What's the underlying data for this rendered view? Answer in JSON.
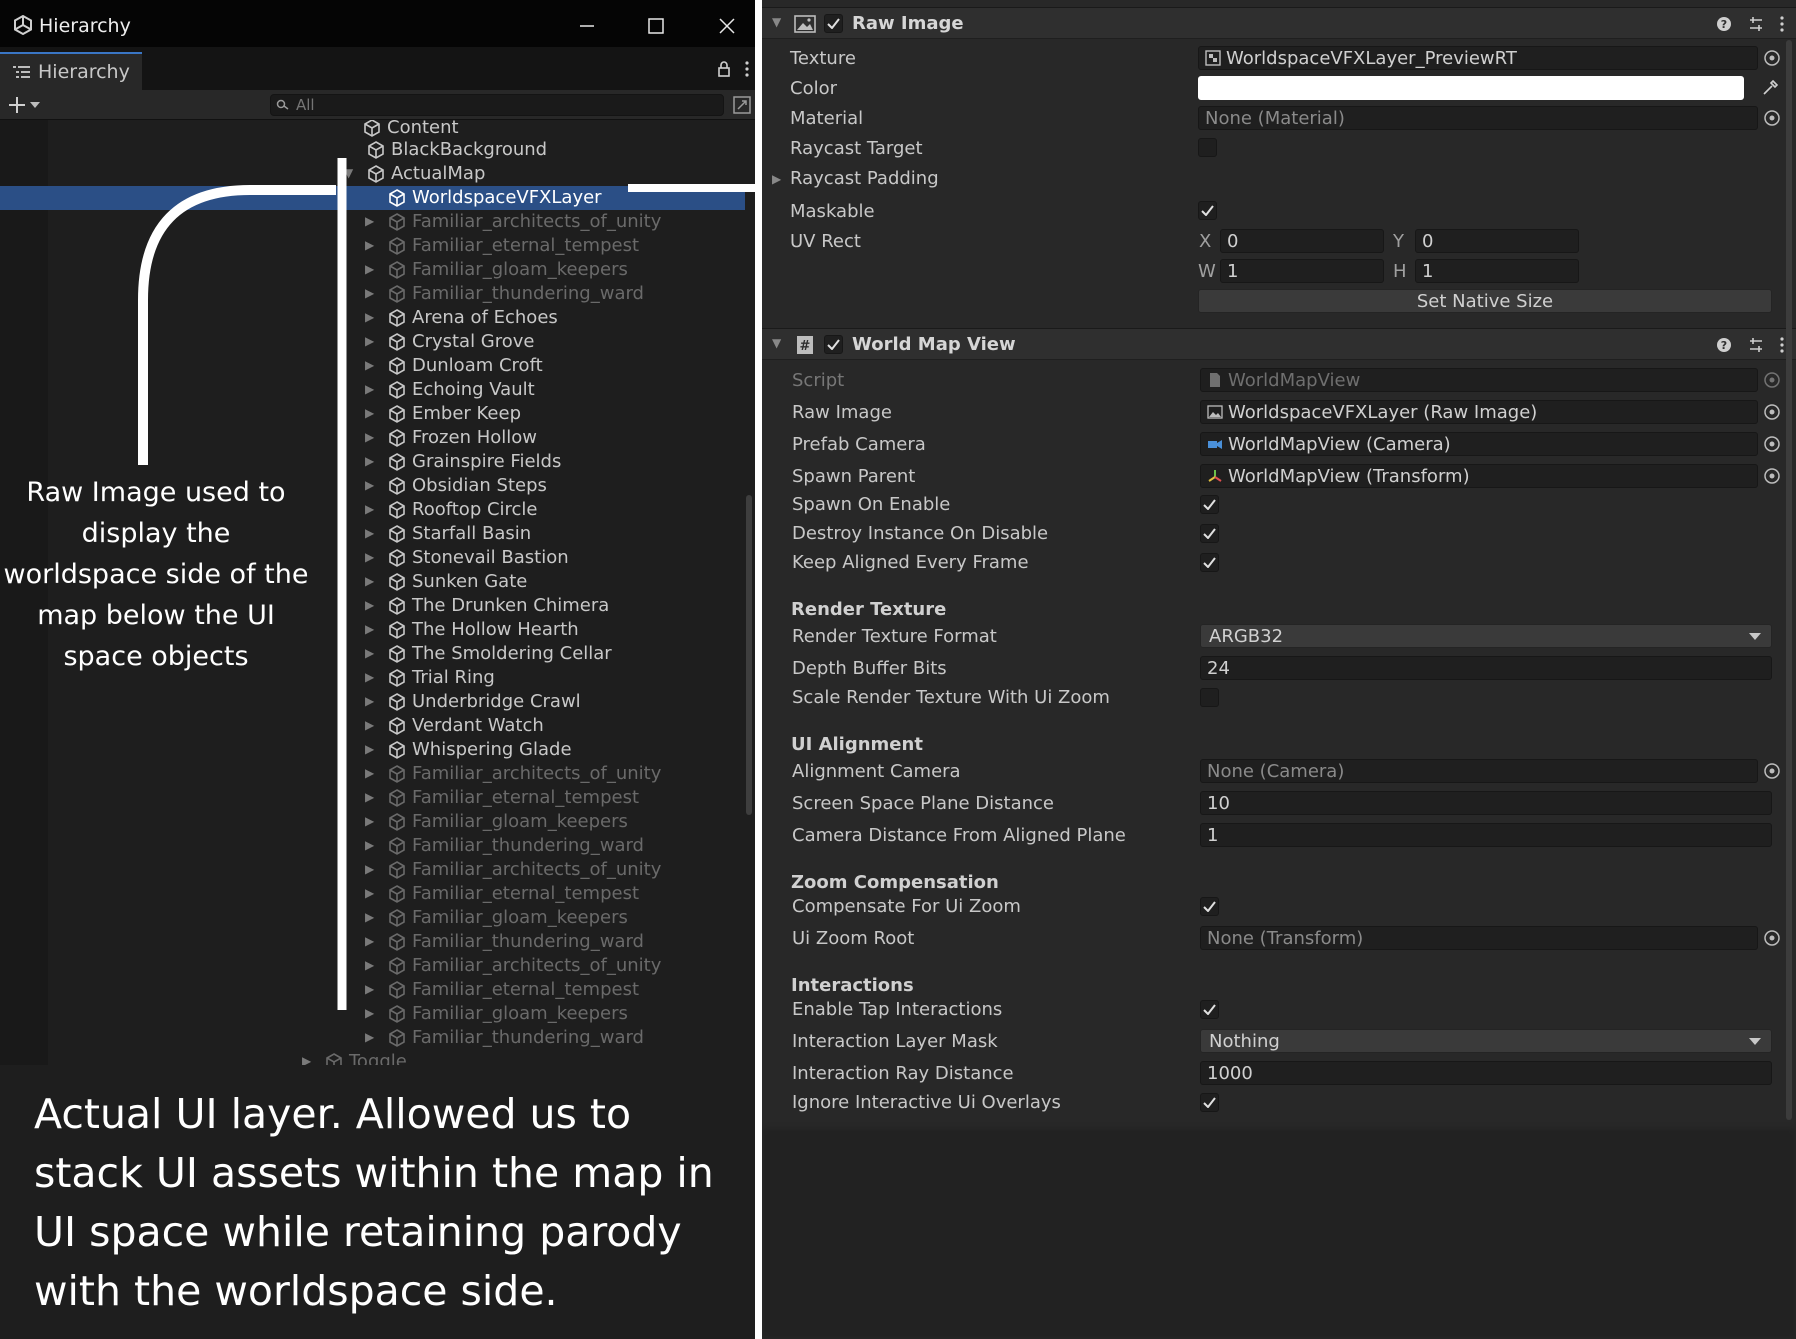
{
  "window": {
    "title": "Hierarchy",
    "minimize_icon": "minimize-icon",
    "maximize_icon": "maximize-icon",
    "close_icon": "close-icon"
  },
  "hierarchy": {
    "tab_label": "Hierarchy",
    "search_placeholder": "All",
    "truncated_top": "Content",
    "items": [
      {
        "label": "BlackBackground",
        "depth": 1,
        "expand": "none",
        "state": "active"
      },
      {
        "label": "ActualMap",
        "depth": 1,
        "expand": "open",
        "state": "active"
      },
      {
        "label": "WorldspaceVFXLayer",
        "depth": 2,
        "expand": "none",
        "state": "selected"
      },
      {
        "label": "Familiar_architects_of_unity",
        "depth": 2,
        "expand": "closed",
        "state": "inactive"
      },
      {
        "label": "Familiar_eternal_tempest",
        "depth": 2,
        "expand": "closed",
        "state": "inactive"
      },
      {
        "label": "Familiar_gloam_keepers",
        "depth": 2,
        "expand": "closed",
        "state": "inactive"
      },
      {
        "label": "Familiar_thundering_ward",
        "depth": 2,
        "expand": "closed",
        "state": "inactive"
      },
      {
        "label": "Arena of Echoes",
        "depth": 2,
        "expand": "closed",
        "state": "active"
      },
      {
        "label": "Crystal Grove",
        "depth": 2,
        "expand": "closed",
        "state": "active"
      },
      {
        "label": "Dunloam Croft",
        "depth": 2,
        "expand": "closed",
        "state": "active"
      },
      {
        "label": "Echoing Vault",
        "depth": 2,
        "expand": "closed",
        "state": "active"
      },
      {
        "label": "Ember Keep",
        "depth": 2,
        "expand": "closed",
        "state": "active"
      },
      {
        "label": "Frozen Hollow",
        "depth": 2,
        "expand": "closed",
        "state": "active"
      },
      {
        "label": "Grainspire Fields",
        "depth": 2,
        "expand": "closed",
        "state": "active"
      },
      {
        "label": "Obsidian Steps",
        "depth": 2,
        "expand": "closed",
        "state": "active"
      },
      {
        "label": "Rooftop Circle",
        "depth": 2,
        "expand": "closed",
        "state": "active"
      },
      {
        "label": "Starfall Basin",
        "depth": 2,
        "expand": "closed",
        "state": "active"
      },
      {
        "label": "Stonevail Bastion",
        "depth": 2,
        "expand": "closed",
        "state": "active"
      },
      {
        "label": "Sunken Gate",
        "depth": 2,
        "expand": "closed",
        "state": "active"
      },
      {
        "label": "The Drunken Chimera",
        "depth": 2,
        "expand": "closed",
        "state": "active"
      },
      {
        "label": "The Hollow Hearth",
        "depth": 2,
        "expand": "closed",
        "state": "active"
      },
      {
        "label": "The Smoldering Cellar",
        "depth": 2,
        "expand": "closed",
        "state": "active"
      },
      {
        "label": "Trial Ring",
        "depth": 2,
        "expand": "closed",
        "state": "active"
      },
      {
        "label": "Underbridge Crawl",
        "depth": 2,
        "expand": "closed",
        "state": "active"
      },
      {
        "label": "Verdant Watch",
        "depth": 2,
        "expand": "closed",
        "state": "active"
      },
      {
        "label": "Whispering Glade",
        "depth": 2,
        "expand": "closed",
        "state": "active"
      },
      {
        "label": "Familiar_architects_of_unity",
        "depth": 2,
        "expand": "closed",
        "state": "inactive"
      },
      {
        "label": "Familiar_eternal_tempest",
        "depth": 2,
        "expand": "closed",
        "state": "inactive"
      },
      {
        "label": "Familiar_gloam_keepers",
        "depth": 2,
        "expand": "closed",
        "state": "inactive"
      },
      {
        "label": "Familiar_thundering_ward",
        "depth": 2,
        "expand": "closed",
        "state": "inactive"
      },
      {
        "label": "Familiar_architects_of_unity",
        "depth": 2,
        "expand": "closed",
        "state": "inactive"
      },
      {
        "label": "Familiar_eternal_tempest",
        "depth": 2,
        "expand": "closed",
        "state": "inactive"
      },
      {
        "label": "Familiar_gloam_keepers",
        "depth": 2,
        "expand": "closed",
        "state": "inactive"
      },
      {
        "label": "Familiar_thundering_ward",
        "depth": 2,
        "expand": "closed",
        "state": "inactive"
      },
      {
        "label": "Familiar_architects_of_unity",
        "depth": 2,
        "expand": "closed",
        "state": "inactive"
      },
      {
        "label": "Familiar_eternal_tempest",
        "depth": 2,
        "expand": "closed",
        "state": "inactive"
      },
      {
        "label": "Familiar_gloam_keepers",
        "depth": 2,
        "expand": "closed",
        "state": "inactive"
      },
      {
        "label": "Familiar_thundering_ward",
        "depth": 2,
        "expand": "closed",
        "state": "inactive"
      },
      {
        "label": "Toggle",
        "depth": 0,
        "expand": "closed",
        "state": "inactive"
      }
    ]
  },
  "annotations": {
    "raw_image_note": "Raw Image used to display the worldspace side of the map below the UI space objects",
    "ui_layer_note": "Actual UI layer. Allowed us to stack UI assets within the map in UI space while retaining parody with the worldspace side."
  },
  "inspector": {
    "raw_image": {
      "title": "Raw Image",
      "enabled": true,
      "texture_label": "Texture",
      "texture_value": "WorldspaceVFXLayer_PreviewRT",
      "color_label": "Color",
      "color_value": "#ffffff",
      "material_label": "Material",
      "material_value": "None (Material)",
      "raycast_target_label": "Raycast Target",
      "raycast_target": false,
      "raycast_padding_label": "Raycast Padding",
      "maskable_label": "Maskable",
      "maskable": true,
      "uv_rect_label": "UV Rect",
      "uv_x_label": "X",
      "uv_x": "0",
      "uv_y_label": "Y",
      "uv_y": "0",
      "uv_w_label": "W",
      "uv_w": "1",
      "uv_h_label": "H",
      "uv_h": "1",
      "set_native_size": "Set Native Size"
    },
    "world_map_view": {
      "title": "World Map View",
      "enabled": true,
      "script_label": "Script",
      "script_value": "WorldMapView",
      "raw_image_label": "Raw Image",
      "raw_image_value": "WorldspaceVFXLayer (Raw Image)",
      "prefab_camera_label": "Prefab Camera",
      "prefab_camera_value": "WorldMapView (Camera)",
      "spawn_parent_label": "Spawn Parent",
      "spawn_parent_value": "WorldMapView (Transform)",
      "spawn_on_enable_label": "Spawn On Enable",
      "spawn_on_enable": true,
      "destroy_on_disable_label": "Destroy Instance On Disable",
      "destroy_on_disable": true,
      "keep_aligned_label": "Keep Aligned Every Frame",
      "keep_aligned": true,
      "render_texture_section": "Render Texture",
      "rt_format_label": "Render Texture Format",
      "rt_format_value": "ARGB32",
      "depth_bits_label": "Depth Buffer Bits",
      "depth_bits_value": "24",
      "scale_rt_label": "Scale Render Texture With Ui Zoom",
      "scale_rt": false,
      "ui_alignment_section": "UI Alignment",
      "alignment_camera_label": "Alignment Camera",
      "alignment_camera_value": "None (Camera)",
      "plane_distance_label": "Screen Space Plane Distance",
      "plane_distance_value": "10",
      "camera_distance_label": "Camera Distance From Aligned Plane",
      "camera_distance_value": "1",
      "zoom_section": "Zoom Compensation",
      "compensate_label": "Compensate For Ui Zoom",
      "compensate": true,
      "zoom_root_label": "Ui Zoom Root",
      "zoom_root_value": "None (Transform)",
      "interactions_section": "Interactions",
      "tap_label": "Enable Tap Interactions",
      "tap": true,
      "layer_mask_label": "Interaction Layer Mask",
      "layer_mask_value": "Nothing",
      "ray_distance_label": "Interaction Ray Distance",
      "ray_distance_value": "1000",
      "ignore_overlays_label": "Ignore Interactive Ui Overlays",
      "ignore_overlays": true
    }
  },
  "colors": {
    "selection": "#2b4f86",
    "panel": "#282828",
    "annotation": "#ffffff"
  }
}
